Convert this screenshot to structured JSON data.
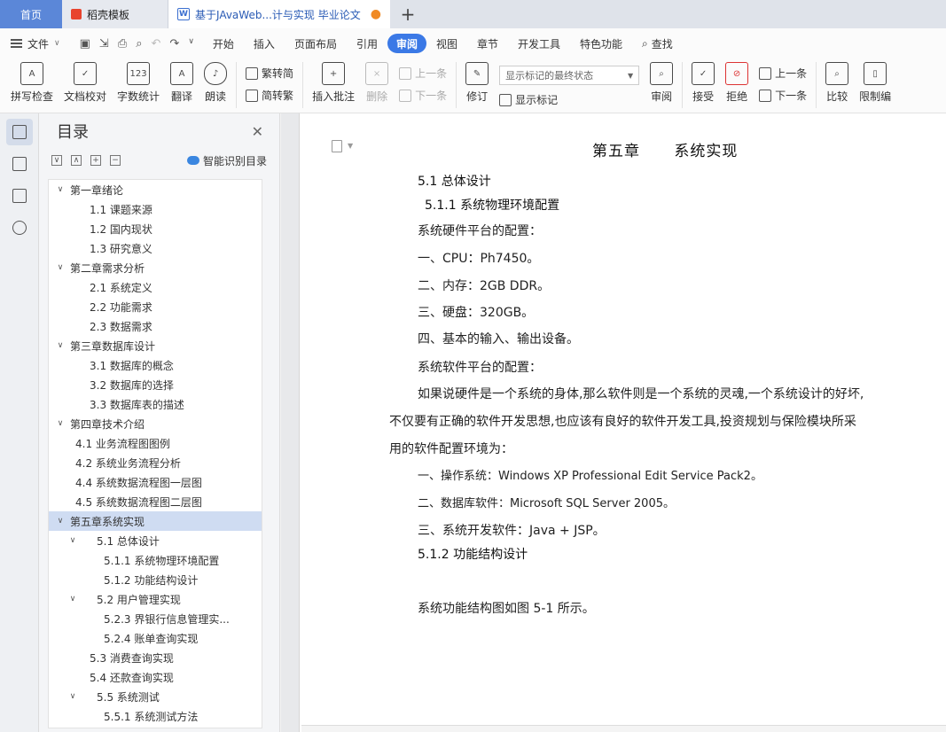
{
  "tabs": {
    "home": "首页",
    "docer": "稻壳模板",
    "doc": "基于JAvaWeb...计与实现 毕业论文",
    "unsaved_dot": "●",
    "plus": "+"
  },
  "menu": {
    "file": "文件",
    "items": [
      "开始",
      "插入",
      "页面布局",
      "引用",
      "审阅",
      "视图",
      "章节",
      "开发工具",
      "特色功能"
    ],
    "active": "审阅",
    "search": "查找"
  },
  "ribbon": {
    "spellcheck": "拼写检查",
    "doccheck": "文档校对",
    "wordcount": "字数统计",
    "translate": "翻译",
    "read": "朗读",
    "trad": "繁转简",
    "simp": "简转繁",
    "insert_comment": "插入批注",
    "delete": "删除",
    "prev": "上一条",
    "next": "下一条",
    "revise": "修订",
    "markup_select": "显示标记的最终状态",
    "show_markup": "显示标记",
    "review": "审阅",
    "accept": "接受",
    "reject": "拒绝",
    "prev2": "上一条",
    "next2": "下一条",
    "compare": "比较",
    "restrict": "限制编"
  },
  "toc": {
    "title": "目录",
    "smart": "智能识别目录",
    "items": [
      {
        "text": "第一章绪论",
        "level": 1,
        "chev": "∨"
      },
      {
        "text": "1.1  课题来源",
        "level": 3
      },
      {
        "text": "1.2  国内现状",
        "level": 3
      },
      {
        "text": "1.3  研究意义",
        "level": 3
      },
      {
        "text": "第二章需求分析",
        "level": 1,
        "chev": "∨"
      },
      {
        "text": "2.1  系统定义",
        "level": 3
      },
      {
        "text": "2.2  功能需求",
        "level": 3
      },
      {
        "text": "2.3  数据需求",
        "level": 3
      },
      {
        "text": "第三章数据库设计",
        "level": 1,
        "chev": "∨"
      },
      {
        "text": "3.1  数据库的概念",
        "level": 3
      },
      {
        "text": "3.2  数据库的选择",
        "level": 3
      },
      {
        "text": "3.3  数据库表的描述",
        "level": 3
      },
      {
        "text": "第四章技术介绍",
        "level": 1,
        "chev": "∨"
      },
      {
        "text": "4.1  业务流程图图例",
        "level": 2
      },
      {
        "text": "4.2 系统业务流程分析",
        "level": 2
      },
      {
        "text": "4.4 系统数据流程图一层图",
        "level": 2
      },
      {
        "text": "4.5  系统数据流程图二层图",
        "level": 2
      },
      {
        "text": "第五章系统实现",
        "level": 1,
        "chev": "∨",
        "selected": true
      },
      {
        "text": "5.1 总体设计",
        "level": "2b",
        "chev": "∨"
      },
      {
        "text": "5.1.1 系统物理环境配置",
        "level": 4
      },
      {
        "text": "5.1.2  功能结构设计",
        "level": 4
      },
      {
        "text": "5.2  用户管理实现",
        "level": "2b",
        "chev": "∨"
      },
      {
        "text": "5.2.3  界银行信息管理实...",
        "level": 4
      },
      {
        "text": "5.2.4  账单查询实现",
        "level": 4
      },
      {
        "text": "5.3  消费查询实现",
        "level": "2c"
      },
      {
        "text": "5.4  还款查询实现",
        "level": "2c"
      },
      {
        "text": "5.5  系统测试",
        "level": "2b",
        "chev": "∨"
      },
      {
        "text": "5.5.1  系统测试方法",
        "level": 4
      }
    ]
  },
  "doc": {
    "chapter": "第五章      系统实现",
    "h1": "5.1 总体设计",
    "h2": "5.1.1 系统物理环境配置",
    "p1": "系统硬件平台的配置：",
    "p2": "一、CPU：Ph7450。",
    "p3": "二、内存：2GB DDR。",
    "p4": "三、硬盘：320GB。",
    "p5": "四、基本的输入、输出设备。",
    "p6": "系统软件平台的配置：",
    "p7a": "如果说硬件是一个系统的身体,那么软件则是一个系统的灵魂,一个系统设计的好坏,",
    "p7b": "不仅要有正确的软件开发思想,也应该有良好的软件开发工具,投资规划与保险模块所采",
    "p7c": "用的软件配置环境为：",
    "p8": "一、操作系统：Windows XP  Professional Edit Service Pack2。",
    "p9": "二、数据库软件：Microsoft SQL Server 2005。",
    "p10": "三、系统开发软件：Java + JSP。",
    "h3": "5.1.2  功能结构设计",
    "p11": "系统功能结构图如图 5-1 所示。"
  }
}
